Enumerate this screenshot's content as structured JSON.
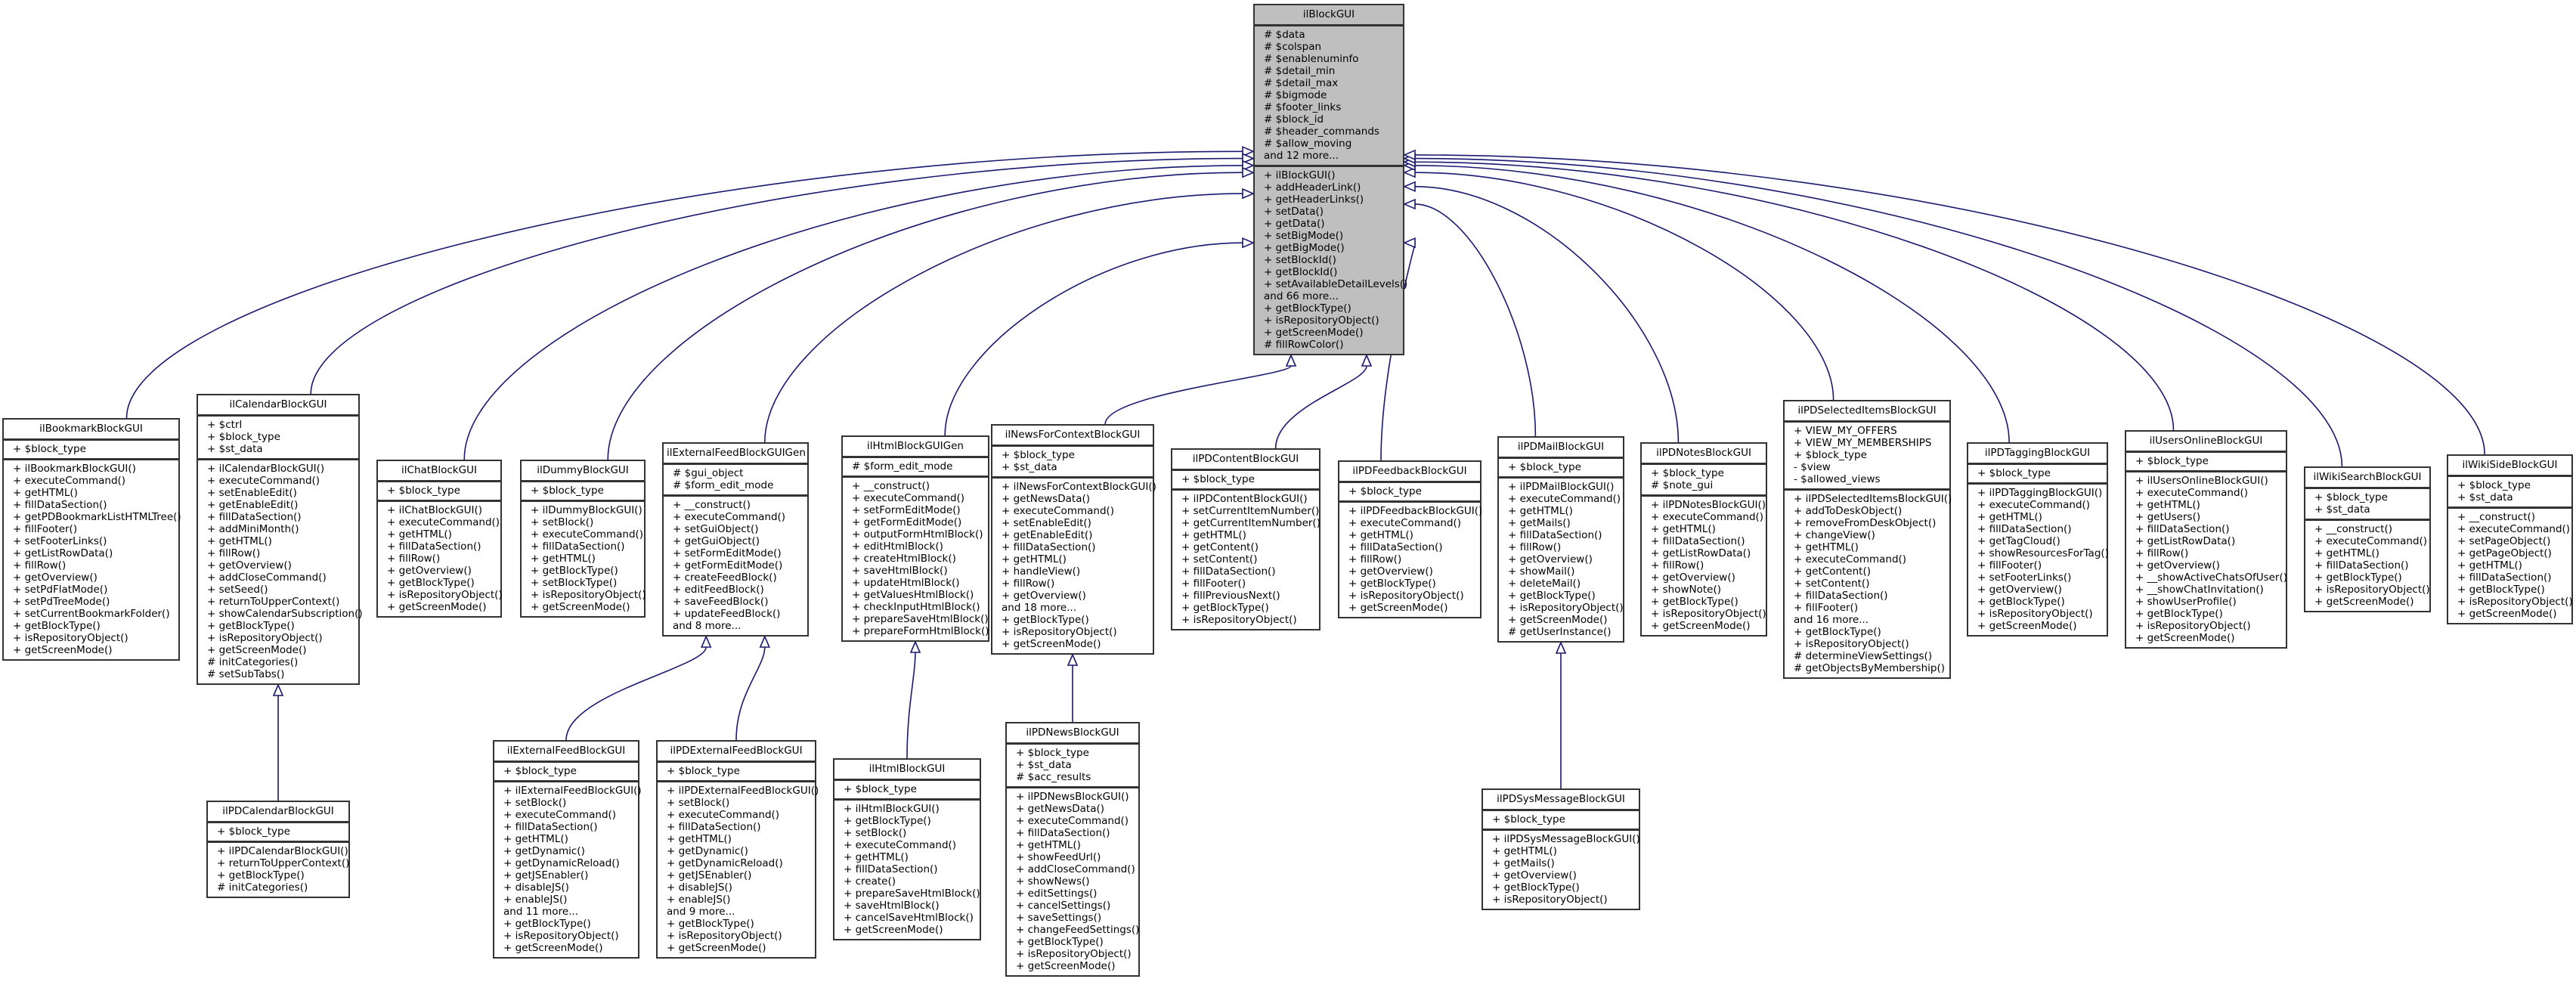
{
  "diagram": {
    "type": "class-inheritance",
    "edge_color": "#191970",
    "root_fill": "#bfbfbf",
    "nodes": [
      {
        "id": "ilBlockGUI",
        "name": "ilBlockGUI",
        "root": true,
        "attributes": [
          "# $data",
          "# $colspan",
          "# $enablenuminfo",
          "# $detail_min",
          "# $detail_max",
          "# $bigmode",
          "# $footer_links",
          "# $block_id",
          "# $header_commands",
          "# $allow_moving",
          "and 12 more..."
        ],
        "methods": [
          "+ ilBlockGUI()",
          "+ addHeaderLink()",
          "+ getHeaderLinks()",
          "+ setData()",
          "+ getData()",
          "+ setBigMode()",
          "+ getBigMode()",
          "+ setBlockId()",
          "+ getBlockId()",
          "+ setAvailableDetailLevels()",
          "and 66 more...",
          "+ getBlockType()",
          "+ isRepositoryObject()",
          "+ getScreenMode()",
          "# fillRowColor()"
        ]
      },
      {
        "id": "ilBookmarkBlockGUI",
        "name": "ilBookmarkBlockGUI",
        "attributes": [
          "+ $block_type"
        ],
        "methods": [
          "+ ilBookmarkBlockGUI()",
          "+ executeCommand()",
          "+ getHTML()",
          "+ fillDataSection()",
          "+ getPDBookmarkListHTMLTree()",
          "+ fillFooter()",
          "+ setFooterLinks()",
          "+ getListRowData()",
          "+ fillRow()",
          "+ getOverview()",
          "+ setPdFlatMode()",
          "+ setPdTreeMode()",
          "+ setCurrentBookmarkFolder()",
          "+ getBlockType()",
          "+ isRepositoryObject()",
          "+ getScreenMode()"
        ]
      },
      {
        "id": "ilCalendarBlockGUI",
        "name": "ilCalendarBlockGUI",
        "attributes": [
          "+ $ctrl",
          "+ $block_type",
          "+ $st_data"
        ],
        "methods": [
          "+ ilCalendarBlockGUI()",
          "+ executeCommand()",
          "+ setEnableEdit()",
          "+ getEnableEdit()",
          "+ fillDataSection()",
          "+ addMiniMonth()",
          "+ getHTML()",
          "+ fillRow()",
          "+ getOverview()",
          "+ addCloseCommand()",
          "+ setSeed()",
          "+ returnToUpperContext()",
          "+ showCalendarSubscription()",
          "+ getBlockType()",
          "+ isRepositoryObject()",
          "+ getScreenMode()",
          "# initCategories()",
          "# setSubTabs()"
        ]
      },
      {
        "id": "ilChatBlockGUI",
        "name": "ilChatBlockGUI",
        "attributes": [
          "+ $block_type"
        ],
        "methods": [
          "+ ilChatBlockGUI()",
          "+ executeCommand()",
          "+ getHTML()",
          "+ fillDataSection()",
          "+ fillRow()",
          "+ getOverview()",
          "+ getBlockType()",
          "+ isRepositoryObject()",
          "+ getScreenMode()"
        ]
      },
      {
        "id": "ilDummyBlockGUI",
        "name": "ilDummyBlockGUI",
        "attributes": [
          "+ $block_type"
        ],
        "methods": [
          "+ ilDummyBlockGUI()",
          "+ setBlock()",
          "+ executeCommand()",
          "+ fillDataSection()",
          "+ getHTML()",
          "+ getBlockType()",
          "+ setBlockType()",
          "+ isRepositoryObject()",
          "+ getScreenMode()"
        ]
      },
      {
        "id": "ilExternalFeedBlockGUIGen",
        "name": "ilExternalFeedBlockGUIGen",
        "attributes": [
          "# $gui_object",
          "# $form_edit_mode"
        ],
        "methods": [
          "+ __construct()",
          "+ executeCommand()",
          "+ setGuiObject()",
          "+ getGuiObject()",
          "+ setFormEditMode()",
          "+ getFormEditMode()",
          "+ createFeedBlock()",
          "+ editFeedBlock()",
          "+ saveFeedBlock()",
          "+ updateFeedBlock()",
          "and 8 more..."
        ]
      },
      {
        "id": "ilHtmlBlockGUIGen",
        "name": "ilHtmlBlockGUIGen",
        "attributes": [
          "# $form_edit_mode"
        ],
        "methods": [
          "+ __construct()",
          "+ executeCommand()",
          "+ setFormEditMode()",
          "+ getFormEditMode()",
          "+ outputFormHtmlBlock()",
          "+ editHtmlBlock()",
          "+ createHtmlBlock()",
          "+ saveHtmlBlock()",
          "+ updateHtmlBlock()",
          "+ getValuesHtmlBlock()",
          "+ checkInputHtmlBlock()",
          "+ prepareSaveHtmlBlock()",
          "+ prepareFormHtmlBlock()"
        ]
      },
      {
        "id": "ilNewsForContextBlockGUI",
        "name": "ilNewsForContextBlockGUI",
        "attributes": [
          "+ $block_type",
          "+ $st_data"
        ],
        "methods": [
          "+ ilNewsForContextBlockGUI()",
          "+ getNewsData()",
          "+ executeCommand()",
          "+ setEnableEdit()",
          "+ getEnableEdit()",
          "+ fillDataSection()",
          "+ getHTML()",
          "+ handleView()",
          "+ fillRow()",
          "+ getOverview()",
          "and 18 more...",
          "+ getBlockType()",
          "+ isRepositoryObject()",
          "+ getScreenMode()"
        ]
      },
      {
        "id": "ilPDContentBlockGUI",
        "name": "ilPDContentBlockGUI",
        "attributes": [
          "+ $block_type"
        ],
        "methods": [
          "+ ilPDContentBlockGUI()",
          "+ setCurrentItemNumber()",
          "+ getCurrentItemNumber()",
          "+ getHTML()",
          "+ getContent()",
          "+ setContent()",
          "+ fillDataSection()",
          "+ fillFooter()",
          "+ fillPreviousNext()",
          "+ getBlockType()",
          "+ isRepositoryObject()"
        ]
      },
      {
        "id": "ilPDFeedbackBlockGUI",
        "name": "ilPDFeedbackBlockGUI",
        "attributes": [
          "+ $block_type"
        ],
        "methods": [
          "+ ilPDFeedbackBlockGUI()",
          "+ executeCommand()",
          "+ getHTML()",
          "+ fillDataSection()",
          "+ fillRow()",
          "+ getOverview()",
          "+ getBlockType()",
          "+ isRepositoryObject()",
          "+ getScreenMode()"
        ]
      },
      {
        "id": "ilPDMailBlockGUI",
        "name": "ilPDMailBlockGUI",
        "attributes": [
          "+ $block_type"
        ],
        "methods": [
          "+ ilPDMailBlockGUI()",
          "+ executeCommand()",
          "+ getHTML()",
          "+ getMails()",
          "+ fillDataSection()",
          "+ fillRow()",
          "+ getOverview()",
          "+ showMail()",
          "+ deleteMail()",
          "+ getBlockType()",
          "+ isRepositoryObject()",
          "+ getScreenMode()",
          "# getUserInstance()"
        ]
      },
      {
        "id": "ilPDNotesBlockGUI",
        "name": "ilPDNotesBlockGUI",
        "attributes": [
          "+ $block_type",
          "# $note_gui"
        ],
        "methods": [
          "+ ilPDNotesBlockGUI()",
          "+ executeCommand()",
          "+ getHTML()",
          "+ fillDataSection()",
          "+ getListRowData()",
          "+ fillRow()",
          "+ getOverview()",
          "+ showNote()",
          "+ getBlockType()",
          "+ isRepositoryObject()",
          "+ getScreenMode()"
        ]
      },
      {
        "id": "ilPDSelectedItemsBlockGUI",
        "name": "ilPDSelectedItemsBlockGUI",
        "attributes": [
          "+ VIEW_MY_OFFERS",
          "+ VIEW_MY_MEMBERSHIPS",
          "+ $block_type",
          "- $view",
          "- $allowed_views"
        ],
        "methods": [
          "+ ilPDSelectedItemsBlockGUI()",
          "+ addToDeskObject()",
          "+ removeFromDeskObject()",
          "+ changeView()",
          "+ getHTML()",
          "+ executeCommand()",
          "+ getContent()",
          "+ setContent()",
          "+ fillDataSection()",
          "+ fillFooter()",
          "and 16 more...",
          "+ getBlockType()",
          "+ isRepositoryObject()",
          "# determineViewSettings()",
          "# getObjectsByMembership()"
        ]
      },
      {
        "id": "ilPDTaggingBlockGUI",
        "name": "ilPDTaggingBlockGUI",
        "attributes": [
          "+ $block_type"
        ],
        "methods": [
          "+ ilPDTaggingBlockGUI()",
          "+ executeCommand()",
          "+ getHTML()",
          "+ fillDataSection()",
          "+ getTagCloud()",
          "+ showResourcesForTag()",
          "+ fillFooter()",
          "+ setFooterLinks()",
          "+ getOverview()",
          "+ getBlockType()",
          "+ isRepositoryObject()",
          "+ getScreenMode()"
        ]
      },
      {
        "id": "ilUsersOnlineBlockGUI",
        "name": "ilUsersOnlineBlockGUI",
        "attributes": [
          "+ $block_type"
        ],
        "methods": [
          "+ ilUsersOnlineBlockGUI()",
          "+ executeCommand()",
          "+ getHTML()",
          "+ getUsers()",
          "+ fillDataSection()",
          "+ getListRowData()",
          "+ fillRow()",
          "+ getOverview()",
          "+ __showActiveChatsOfUser()",
          "+ __showChatInvitation()",
          "+ showUserProfile()",
          "+ getBlockType()",
          "+ isRepositoryObject()",
          "+ getScreenMode()"
        ]
      },
      {
        "id": "ilWikiSearchBlockGUI",
        "name": "ilWikiSearchBlockGUI",
        "attributes": [
          "+ $block_type",
          "+ $st_data"
        ],
        "methods": [
          "+ __construct()",
          "+ executeCommand()",
          "+ getHTML()",
          "+ fillDataSection()",
          "+ getBlockType()",
          "+ isRepositoryObject()",
          "+ getScreenMode()"
        ]
      },
      {
        "id": "ilWikiSideBlockGUI",
        "name": "ilWikiSideBlockGUI",
        "attributes": [
          "+ $block_type",
          "+ $st_data"
        ],
        "methods": [
          "+ __construct()",
          "+ executeCommand()",
          "+ setPageObject()",
          "+ getPageObject()",
          "+ getHTML()",
          "+ fillDataSection()",
          "+ getBlockType()",
          "+ isRepositoryObject()",
          "+ getScreenMode()"
        ]
      },
      {
        "id": "ilPDCalendarBlockGUI",
        "name": "ilPDCalendarBlockGUI",
        "attributes": [
          "+ $block_type"
        ],
        "methods": [
          "+ ilPDCalendarBlockGUI()",
          "+ returnToUpperContext()",
          "+ getBlockType()",
          "# initCategories()"
        ]
      },
      {
        "id": "ilExternalFeedBlockGUI",
        "name": "ilExternalFeedBlockGUI",
        "attributes": [
          "+ $block_type"
        ],
        "methods": [
          "+ ilExternalFeedBlockGUI()",
          "+ setBlock()",
          "+ executeCommand()",
          "+ fillDataSection()",
          "+ getHTML()",
          "+ getDynamic()",
          "+ getDynamicReload()",
          "+ getJSEnabler()",
          "+ disableJS()",
          "+ enableJS()",
          "and 11 more...",
          "+ getBlockType()",
          "+ isRepositoryObject()",
          "+ getScreenMode()"
        ]
      },
      {
        "id": "ilPDExternalFeedBlockGUI",
        "name": "ilPDExternalFeedBlockGUI",
        "attributes": [
          "+ $block_type"
        ],
        "methods": [
          "+ ilPDExternalFeedBlockGUI()",
          "+ setBlock()",
          "+ executeCommand()",
          "+ fillDataSection()",
          "+ getHTML()",
          "+ getDynamic()",
          "+ getDynamicReload()",
          "+ getJSEnabler()",
          "+ disableJS()",
          "+ enableJS()",
          "and 9 more...",
          "+ getBlockType()",
          "+ isRepositoryObject()",
          "+ getScreenMode()"
        ]
      },
      {
        "id": "ilHtmlBlockGUI",
        "name": "ilHtmlBlockGUI",
        "attributes": [
          "+ $block_type"
        ],
        "methods": [
          "+ ilHtmlBlockGUI()",
          "+ getBlockType()",
          "+ setBlock()",
          "+ executeCommand()",
          "+ getHTML()",
          "+ fillDataSection()",
          "+ create()",
          "+ prepareSaveHtmlBlock()",
          "+ saveHtmlBlock()",
          "+ cancelSaveHtmlBlock()",
          "+ getScreenMode()"
        ]
      },
      {
        "id": "ilPDNewsBlockGUI",
        "name": "ilPDNewsBlockGUI",
        "attributes": [
          "+ $block_type",
          "+ $st_data",
          "# $acc_results"
        ],
        "methods": [
          "+ ilPDNewsBlockGUI()",
          "+ getNewsData()",
          "+ executeCommand()",
          "+ fillDataSection()",
          "+ getHTML()",
          "+ showFeedUrl()",
          "+ addCloseCommand()",
          "+ showNews()",
          "+ editSettings()",
          "+ cancelSettings()",
          "+ saveSettings()",
          "+ changeFeedSettings()",
          "+ getBlockType()",
          "+ isRepositoryObject()",
          "+ getScreenMode()"
        ]
      },
      {
        "id": "ilPDSysMessageBlockGUI",
        "name": "ilPDSysMessageBlockGUI",
        "attributes": [
          "+ $block_type"
        ],
        "methods": [
          "+ ilPDSysMessageBlockGUI()",
          "+ getHTML()",
          "+ getMails()",
          "+ getOverview()",
          "+ getBlockType()",
          "+ isRepositoryObject()"
        ]
      }
    ],
    "edges": [
      {
        "child": "ilBookmarkBlockGUI",
        "parent": "ilBlockGUI"
      },
      {
        "child": "ilCalendarBlockGUI",
        "parent": "ilBlockGUI"
      },
      {
        "child": "ilChatBlockGUI",
        "parent": "ilBlockGUI"
      },
      {
        "child": "ilDummyBlockGUI",
        "parent": "ilBlockGUI"
      },
      {
        "child": "ilExternalFeedBlockGUIGen",
        "parent": "ilBlockGUI"
      },
      {
        "child": "ilHtmlBlockGUIGen",
        "parent": "ilBlockGUI"
      },
      {
        "child": "ilNewsForContextBlockGUI",
        "parent": "ilBlockGUI"
      },
      {
        "child": "ilPDContentBlockGUI",
        "parent": "ilBlockGUI"
      },
      {
        "child": "ilPDFeedbackBlockGUI",
        "parent": "ilBlockGUI"
      },
      {
        "child": "ilPDMailBlockGUI",
        "parent": "ilBlockGUI"
      },
      {
        "child": "ilPDNotesBlockGUI",
        "parent": "ilBlockGUI"
      },
      {
        "child": "ilPDSelectedItemsBlockGUI",
        "parent": "ilBlockGUI"
      },
      {
        "child": "ilPDTaggingBlockGUI",
        "parent": "ilBlockGUI"
      },
      {
        "child": "ilUsersOnlineBlockGUI",
        "parent": "ilBlockGUI"
      },
      {
        "child": "ilWikiSearchBlockGUI",
        "parent": "ilBlockGUI"
      },
      {
        "child": "ilWikiSideBlockGUI",
        "parent": "ilBlockGUI"
      },
      {
        "child": "ilPDCalendarBlockGUI",
        "parent": "ilCalendarBlockGUI"
      },
      {
        "child": "ilExternalFeedBlockGUI",
        "parent": "ilExternalFeedBlockGUIGen"
      },
      {
        "child": "ilPDExternalFeedBlockGUI",
        "parent": "ilExternalFeedBlockGUIGen"
      },
      {
        "child": "ilHtmlBlockGUI",
        "parent": "ilHtmlBlockGUIGen"
      },
      {
        "child": "ilPDNewsBlockGUI",
        "parent": "ilNewsForContextBlockGUI"
      },
      {
        "child": "ilPDSysMessageBlockGUI",
        "parent": "ilPDMailBlockGUI"
      }
    ]
  }
}
